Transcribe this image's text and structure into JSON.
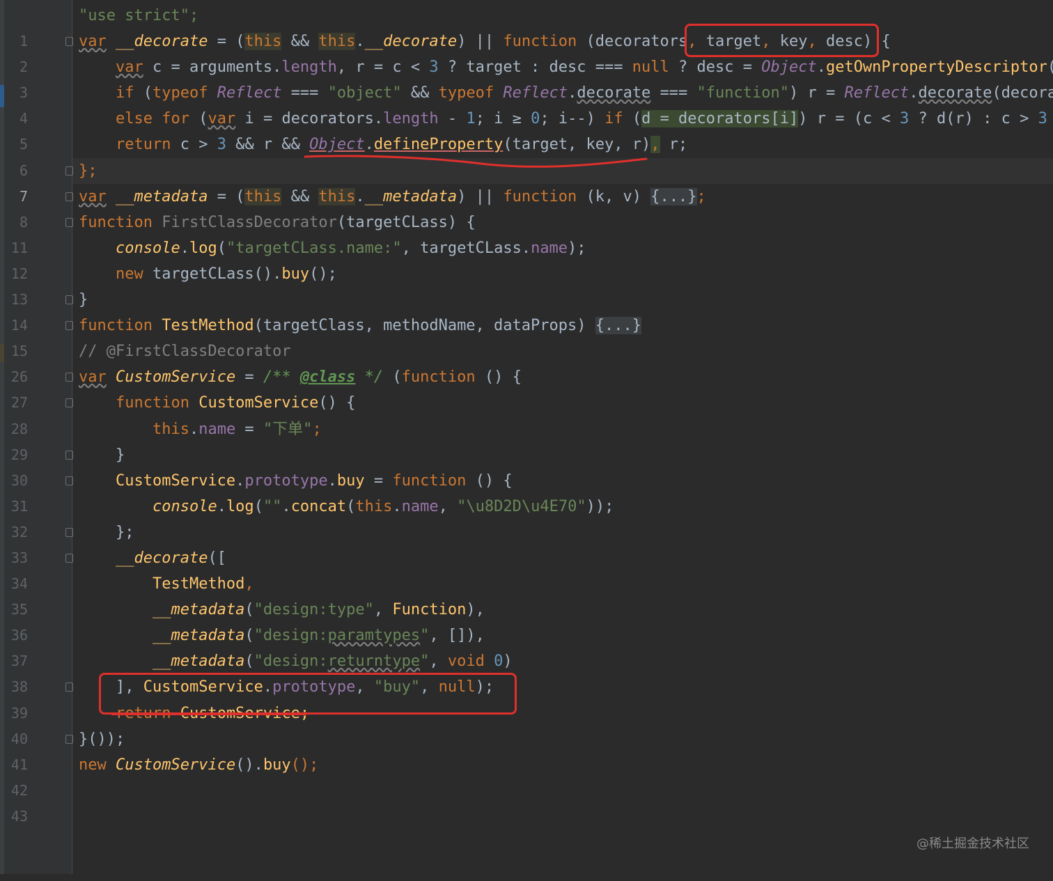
{
  "editor": {
    "watermark": "@稀土掘金技术社区",
    "current_line": "7"
  },
  "lines": [
    {
      "n": "1"
    },
    {
      "n": "2"
    },
    {
      "n": "3"
    },
    {
      "n": "4"
    },
    {
      "n": "5"
    },
    {
      "n": "6"
    },
    {
      "n": "7"
    },
    {
      "n": "8"
    },
    {
      "n": "11"
    },
    {
      "n": "12"
    },
    {
      "n": "13"
    },
    {
      "n": "14"
    },
    {
      "n": "15"
    },
    {
      "n": "26"
    },
    {
      "n": "27"
    },
    {
      "n": "28"
    },
    {
      "n": "29"
    },
    {
      "n": "30"
    },
    {
      "n": "31"
    },
    {
      "n": "32"
    },
    {
      "n": "33"
    },
    {
      "n": "34"
    },
    {
      "n": "35"
    },
    {
      "n": "36"
    },
    {
      "n": "37"
    },
    {
      "n": "38"
    },
    {
      "n": "39"
    },
    {
      "n": "40"
    },
    {
      "n": "41"
    },
    {
      "n": "42"
    },
    {
      "n": "43"
    }
  ],
  "code": {
    "l1": "\"use strict\";",
    "l2_a": "var",
    "l2_b": "__decorate",
    "l2_c": " = (",
    "l2_this1": "this",
    "l2_d": " && ",
    "l2_this2": "this",
    "l2_e": ".",
    "l2_f": "__decorate",
    "l2_g": ") || ",
    "l2_fn": "function",
    "l2_h": " (decorators",
    "l2_comma": ",",
    "l2_i": " target",
    "l2_j": ", ",
    "l2_k": "key",
    "l2_l": ", ",
    "l2_m": "desc) {",
    "l3_var": "var",
    "l3_a": " c = arguments.",
    "l3_len": "length",
    "l3_b": ", r = c < ",
    "l3_3": "3",
    "l3_c": " ? target : desc ",
    "l3_eq": "===",
    "l3_d": " ",
    "l3_null": "null",
    "l3_e": " ? desc = ",
    "l3_obj": "Object",
    "l3_f": ".",
    "l3_gopd": "getOwnPropertyDescriptor",
    "l3_g": "(ta",
    "l4_if": "if",
    "l4_a": " (",
    "l4_typeof": "typeof",
    "l4_b": " ",
    "l4_refl": "Reflect",
    "l4_c": " ",
    "l4_eq": "===",
    "l4_d": " ",
    "l4_obj": "\"object\"",
    "l4_e": " && ",
    "l4_typeof2": "typeof",
    "l4_f": " ",
    "l4_refl2": "Reflect",
    "l4_g": ".",
    "l4_dec": "decorate",
    "l4_h": " ",
    "l4_eq2": "===",
    "l4_i": " ",
    "l4_fnstr": "\"function\"",
    "l4_j": ") r = ",
    "l4_refl3": "Reflect",
    "l4_k": ".",
    "l4_dec2": "decorate",
    "l4_l": "(decorato",
    "l5_else": "else",
    "l5_a": " ",
    "l5_for": "for",
    "l5_b": " (",
    "l5_var": "var",
    "l5_c": " i = decorators.",
    "l5_len": "length",
    "l5_d": " - ",
    "l5_1": "1",
    "l5_e": "; i ",
    "l5_ge": "≥",
    "l5_f": " ",
    "l5_0": "0",
    "l5_g": "; i--) ",
    "l5_if": "if",
    "l5_h": " (",
    "l5_hl": "d = decorators[i]",
    "l5_i": ") r = (c < ",
    "l5_3": "3",
    "l5_j": " ? d(r) : c > ",
    "l5_3b": "3",
    "l5_k": " ?",
    "l6_ret": "return",
    "l6_a": " c > ",
    "l6_3": "3",
    "l6_b": " && r && ",
    "l6_obj": "Object",
    "l6_c": ".",
    "l6_dp": "defineProperty",
    "l6_d": "(target, key, r)",
    "l6_comma": ",",
    "l6_e": " r;",
    "l7": "};",
    "l8_var": "var",
    "l8_a": " ",
    "l8_md": "__metadata",
    "l8_b": " = (",
    "l8_this1": "this",
    "l8_c": " && ",
    "l8_this2": "this",
    "l8_d": ".",
    "l8_md2": "__metadata",
    "l8_e": ") || ",
    "l8_fn": "function",
    "l8_f": " (k, v) ",
    "l8_chip": "{...}",
    "l8_g": ";",
    "l11_fn": "function",
    "l11_a": " ",
    "l11_name": "FirstClassDecorator",
    "l11_b": "(targetCLass) {",
    "l12_console": "console",
    "l12_a": ".",
    "l12_log": "log",
    "l12_b": "(",
    "l12_str": "\"targetCLass.name:\"",
    "l12_c": ", targetCLass.",
    "l12_name": "name",
    "l12_d": ");",
    "l13_new": "new",
    "l13_a": " targetCLass().",
    "l13_buy": "buy",
    "l13_b": "();",
    "l14": "}",
    "l15_fn": "function",
    "l15_a": " ",
    "l15_name": "TestMethod",
    "l15_b": "(targetClass, methodName, dataProps) ",
    "l15_chip": "{...}",
    "l26": "// @FirstClassDecorator",
    "l27_var": "var",
    "l27_a": " ",
    "l27_cs": "CustomService",
    "l27_b": " = ",
    "l27_doc1": "/** ",
    "l27_tag": "@class",
    "l27_doc2": " */",
    "l27_c": " (",
    "l27_fn": "function",
    "l27_d": " () {",
    "l28_fn": "function",
    "l28_a": " ",
    "l28_name": "CustomService",
    "l28_b": "() {",
    "l29_this": "this",
    "l29_a": ".",
    "l29_name": "name",
    "l29_b": " = ",
    "l29_str": "\"下单\"",
    "l29_c": ";",
    "l30": "}",
    "l31_cs": "CustomService",
    "l31_a": ".",
    "l31_proto": "prototype",
    "l31_b": ".",
    "l31_buy": "buy",
    "l31_c": " = ",
    "l31_fn": "function",
    "l31_d": " () {",
    "l32_console": "console",
    "l32_a": ".",
    "l32_log": "log",
    "l32_b": "(",
    "l32_str1": "\"\"",
    "l32_c": ".",
    "l32_concat": "concat",
    "l32_d": "(",
    "l32_this": "this",
    "l32_e": ".",
    "l32_name": "name",
    "l32_f": ", ",
    "l32_str2": "\"\\u8D2D\\u4E70\"",
    "l32_g": "));",
    "l33": "};",
    "l34_dec": "__decorate",
    "l34_a": "([",
    "l35_tm": "TestMethod",
    "l35_a": ",",
    "l36_md": "__metadata",
    "l36_a": "(",
    "l36_str": "\"design:type\"",
    "l36_b": ", ",
    "l36_fn": "Function",
    "l36_c": "),",
    "l37_md": "__metadata",
    "l37_a": "(",
    "l37_str1": "\"design:",
    "l37_str2": "paramtypes",
    "l37_str3": "\"",
    "l37_b": ", []),",
    "l38_md": "__metadata",
    "l38_a": "(",
    "l38_str1": "\"design:",
    "l38_str2": "returntype",
    "l38_str3": "\"",
    "l38_b": ", ",
    "l38_void": "void",
    "l38_c": " ",
    "l38_0": "0",
    "l38_d": ")",
    "l39_a": "], ",
    "l39_cs": "CustomService",
    "l39_b": ".",
    "l39_proto": "prototype",
    "l39_c": ", ",
    "l39_str": "\"buy\"",
    "l39_d": ", ",
    "l39_null": "null",
    "l39_e": ");",
    "l40_ret": "return",
    "l40_a": " CustomService;",
    "l41": "}());",
    "l42_new": "new",
    "l42_a": " ",
    "l42_cs": "CustomService",
    "l42_b": "().",
    "l42_buy": "buy",
    "l42_c": "();"
  },
  "colors": {
    "background": "#2b2b2b",
    "gutter": "#313335",
    "keyword": "#cc7832",
    "string": "#6a8759",
    "number": "#6897bb",
    "function": "#ffc66d",
    "global": "#9876aa",
    "annotation_red": "#e0302c"
  }
}
